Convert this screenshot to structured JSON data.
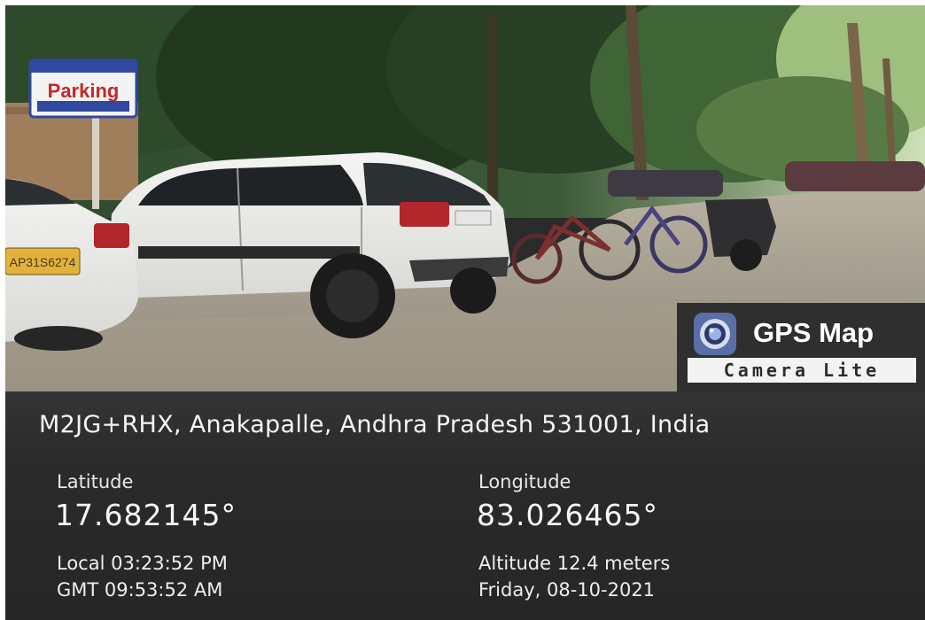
{
  "scene": {
    "parking_sign": "Parking",
    "plate_text": "AP31S6274"
  },
  "badge": {
    "icon": "camera-lens-icon",
    "title": "GPS Map",
    "subtitle": "Camera Lite"
  },
  "location": {
    "address": "M2JG+RHX, Anakapalle, Andhra Pradesh 531001, India",
    "latitude_label": "Latitude",
    "latitude": "17.682145°",
    "longitude_label": "Longitude",
    "longitude": "83.026465°",
    "local_time": "Local 03:23:52 PM",
    "gmt_time": "GMT 09:53:52 AM",
    "altitude": "Altitude 12.4 meters",
    "date": "Friday, 08-10-2021"
  }
}
